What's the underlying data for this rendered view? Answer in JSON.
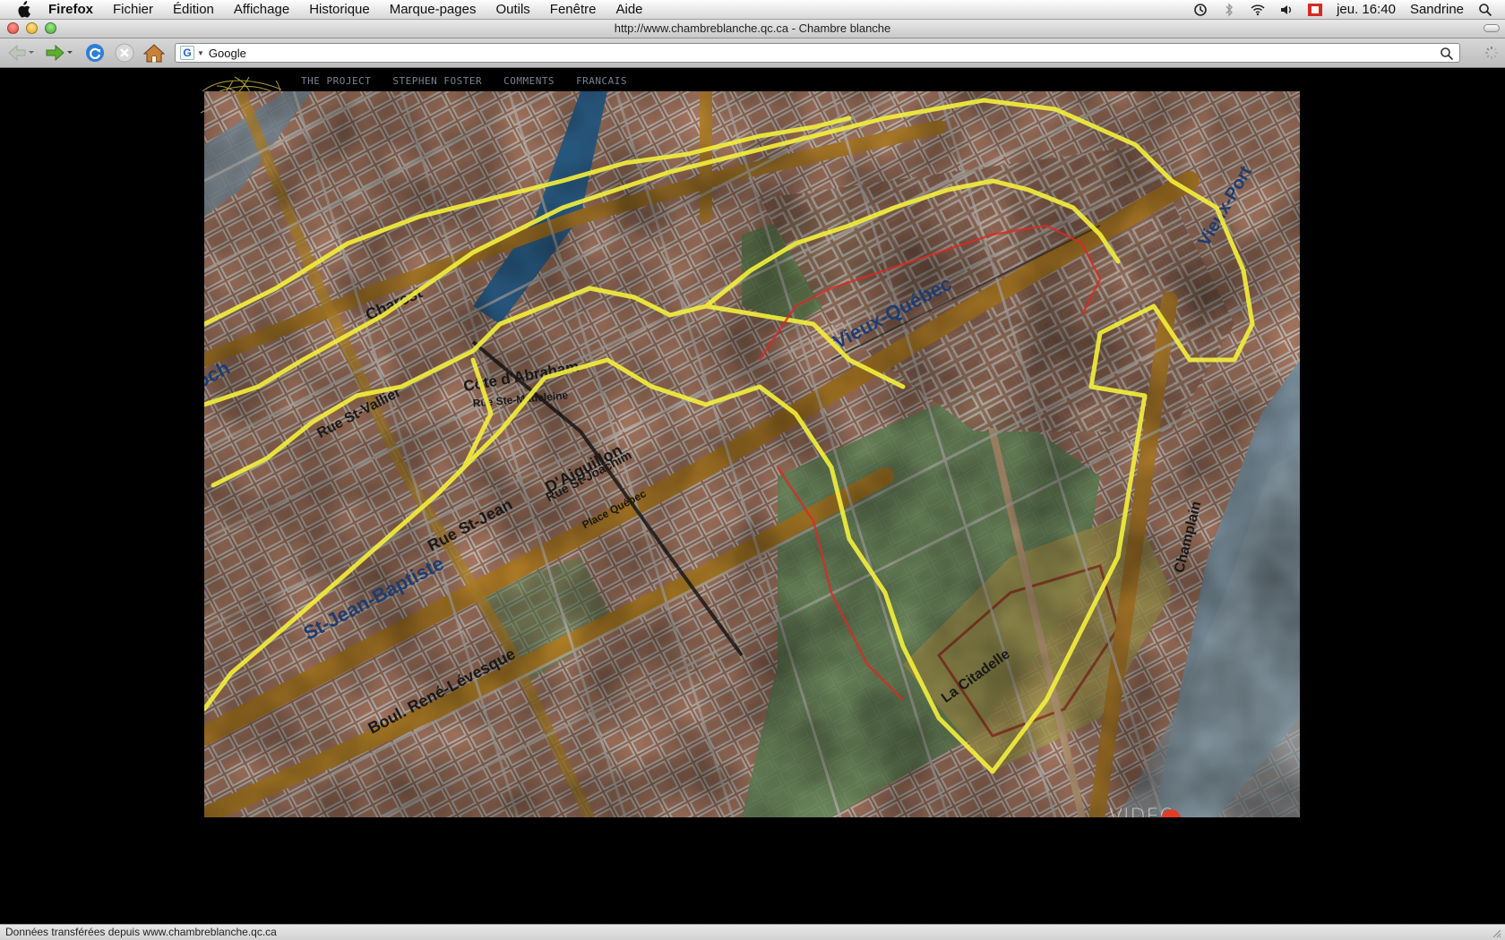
{
  "menubar": {
    "apple_icon": "apple-icon",
    "app_name": "Firefox",
    "menus": [
      "Fichier",
      "Édition",
      "Affichage",
      "Historique",
      "Marque-pages",
      "Outils",
      "Fenêtre",
      "Aide"
    ],
    "flag_label": "CSA",
    "clock": "jeu. 16:40",
    "user": "Sandrine"
  },
  "window": {
    "title": "http://www.chambreblanche.qc.ca - Chambre blanche"
  },
  "toolbar": {
    "search_engine_icon": "G",
    "search_value": "Google"
  },
  "site": {
    "nav": [
      "THE PROJECT",
      "STEPHEN FOSTER",
      "COMMENTS",
      "FRANCAIS"
    ],
    "video_label": "VIDEO",
    "map_labels": [
      "Rue St-Vallier",
      "St-Roch",
      "Charest",
      "Côte d'Abraham",
      "Rue St-Jean",
      "Boul. René-Lévesque",
      "St-Jean-Baptiste",
      "Vieux-Québec",
      "La Citadelle",
      "Champlain",
      "Place Québec",
      "Rue St-Joachim",
      "D'Aiguillon",
      "Rue Ste-Madeleine",
      "Vieux-Port"
    ],
    "colors": {
      "route": "#f2f23a",
      "accent_red": "#e23b26"
    }
  },
  "statusbar": {
    "text": "Données transférées depuis www.chambreblanche.qc.ca"
  }
}
